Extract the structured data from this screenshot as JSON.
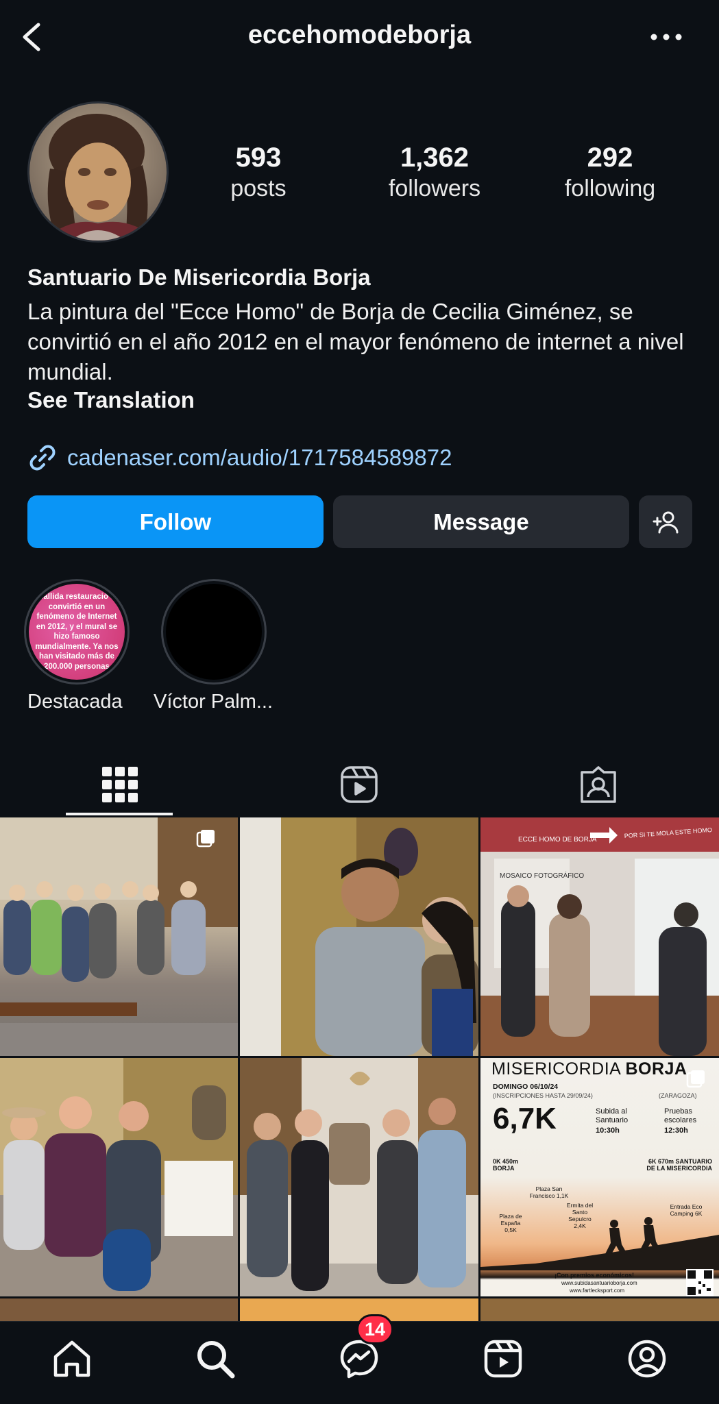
{
  "header": {
    "username": "eccehomodeborja"
  },
  "stats": {
    "posts": {
      "value": "593",
      "label": "posts"
    },
    "followers": {
      "value": "1,362",
      "label": "followers"
    },
    "following": {
      "value": "292",
      "label": "following"
    }
  },
  "bio": {
    "name": "Santuario De Misericordia Borja",
    "text": "La pintura del \"Ecce Homo\" de Borja de Cecilia Giménez, se convirtió en el año 2012 en el mayor fenómeno de internet a nivel mundial.",
    "see_translation": "See Translation",
    "link": "cadenaser.com/audio/1717584589872"
  },
  "actions": {
    "follow": "Follow",
    "message": "Message"
  },
  "highlights": [
    {
      "label": "Destacada",
      "cover_text": "a fallida restauració se convirtió en un fenómeno de Internet en 2012, y el mural se hizo famoso mundialmente. Ya nos han visitado más de 200.000 personas"
    },
    {
      "label": "Víctor Palm..."
    }
  ],
  "tabs": [
    "grid-icon",
    "reels-icon",
    "tagged-icon"
  ],
  "grid_posts": {
    "poster": {
      "title_a": "MISERICORDIA",
      "title_b": "BORJA",
      "date": "DOMINGO 06/10/24",
      "inscr": "(INSCRIPCIONES HASTA 29/09/24)",
      "place": "(ZARAGOZA)",
      "distance": "6,7K",
      "subida": "Subida al Santuario",
      "time1": "10:30h",
      "pruebas": "Pruebas escolares",
      "time2": "12:30h",
      "start": "0K 450m BORJA",
      "end": "6K 670m SANTUARIO DE LA MISERICORDIA",
      "plaza_sf": "Plaza San Francisco 1,1K",
      "ermita": "Ermita del Santo Sepulcro 2,4K",
      "plaza_es": "Plaza de España 0,5K",
      "entrada": "Entrada Eco Camping 6K",
      "premios": "¡Con premios económicos!",
      "web1": "www.subidasantuarioborja.com",
      "web2": "www.fartlecksport.com"
    },
    "banner_1": "ECCE HOMO DE BORJA",
    "banner_2": "MOSAICO FOTOGRÁFICO",
    "banner_3": "POR SI TE MOLA ESTE HOMO"
  },
  "nav": {
    "messages_badge": "14"
  },
  "colors": {
    "background": "#0c1015",
    "accent": "#0a95f6",
    "link": "#9fd2ff",
    "badge": "#ff2e48"
  }
}
